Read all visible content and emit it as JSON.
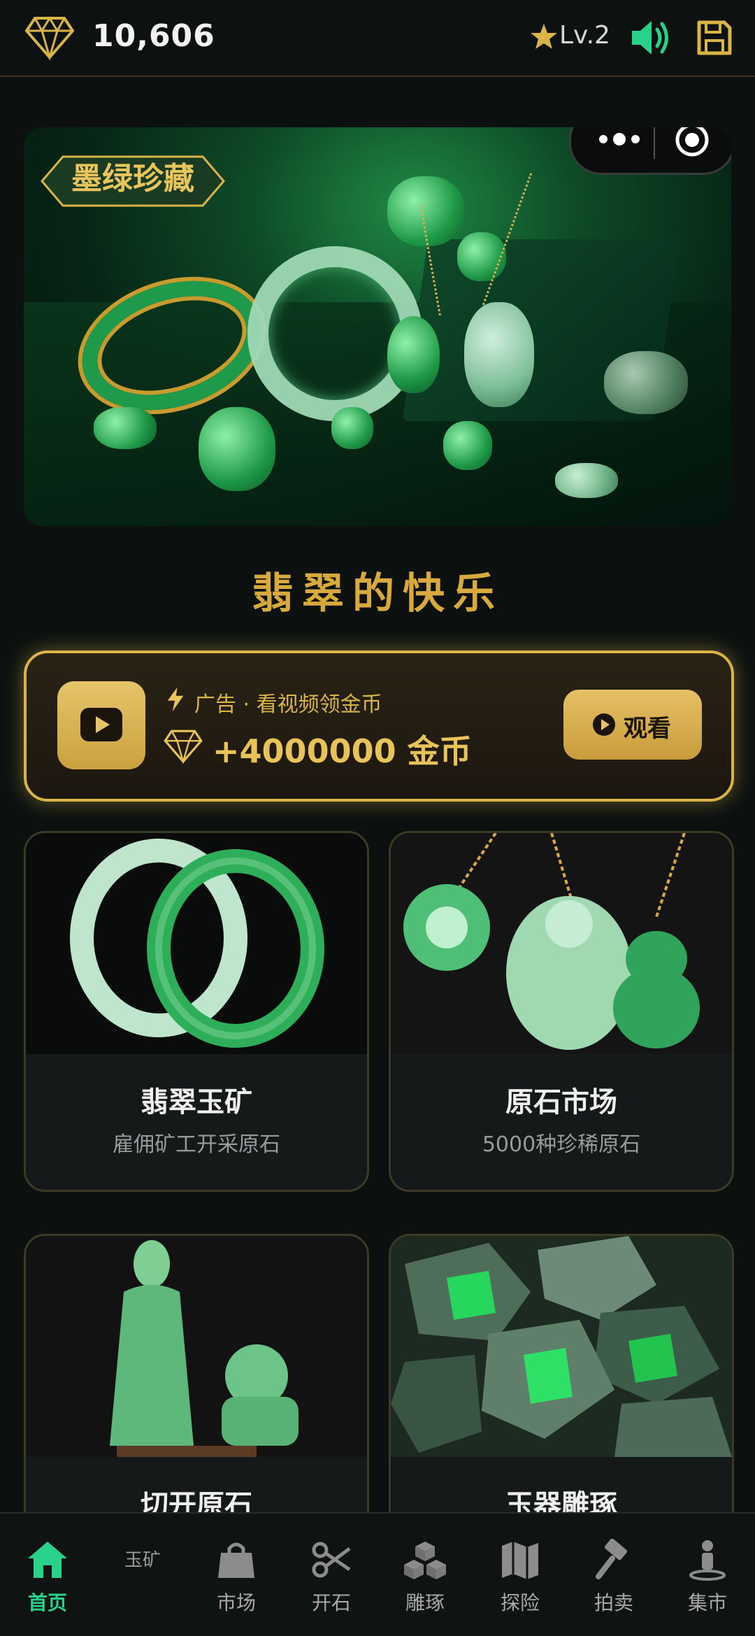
{
  "header": {
    "coins": "10,606",
    "level": "Lv.2"
  },
  "hero": {
    "logo_text": "墨绿珍藏"
  },
  "section_title": "翡翠的快乐",
  "ad": {
    "caption": "广告 · 看视频领金币",
    "reward": "+4000000 金币",
    "button_label": "观看"
  },
  "cards": [
    {
      "title": "翡翠玉矿",
      "subtitle": "雇佣矿工开采原石"
    },
    {
      "title": "原石市场",
      "subtitle": "5000种珍稀原石"
    },
    {
      "title": "切开原石",
      "subtitle": ""
    },
    {
      "title": "玉器雕琢",
      "subtitle": ""
    }
  ],
  "nav": {
    "items": [
      {
        "label": "首页",
        "icon": "home-icon",
        "active": true
      },
      {
        "label": "玉矿",
        "icon": "",
        "active": false
      },
      {
        "label": "市场",
        "icon": "bag-icon",
        "active": false
      },
      {
        "label": "开石",
        "icon": "scissors-icon",
        "active": false
      },
      {
        "label": "雕琢",
        "icon": "cubes-icon",
        "active": false
      },
      {
        "label": "探险",
        "icon": "map-icon",
        "active": false
      },
      {
        "label": "拍卖",
        "icon": "gavel-icon",
        "active": false
      },
      {
        "label": "集市",
        "icon": "person-icon",
        "active": false
      }
    ]
  },
  "colors": {
    "accent_gold": "#d9b447",
    "accent_green": "#29d18a",
    "background": "#0c1110"
  }
}
